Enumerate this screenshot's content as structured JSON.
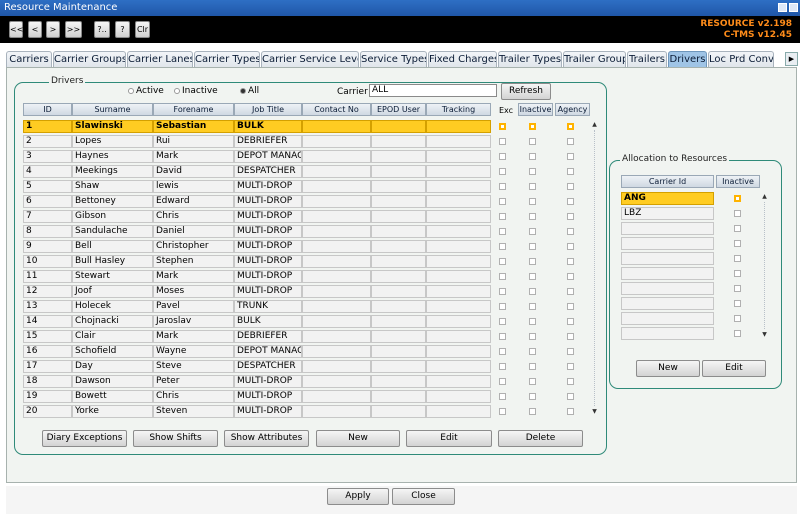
{
  "window": {
    "title": "Resource Maintenance"
  },
  "toolbar": {
    "buttons": [
      "<<",
      "<",
      ">",
      ">>",
      "?..",
      "?",
      "Clr"
    ],
    "version_resource": "RESOURCE v2.198",
    "version_ctms": "C-TMS v12.45"
  },
  "tabs": [
    "Carriers",
    "Carrier Groups",
    "Carrier Lanes",
    "Carrier Types",
    "Carrier Service Level",
    "Service Types",
    "Fixed Charges",
    "Trailer Types",
    "Trailer Group",
    "Trailers",
    "Drivers",
    "Loc Prd Conv"
  ],
  "tab_scroll_icon": "chevron-right-icon",
  "drivers": {
    "group_title": "Drivers",
    "filter": {
      "active_label": "Active",
      "inactive_label": "Inactive",
      "all_label": "All",
      "selected": "All"
    },
    "carrier_label": "Carrier",
    "carrier_value": "ALL",
    "refresh_label": "Refresh",
    "columns": [
      "ID",
      "Surname",
      "Forename",
      "Job Title",
      "Contact No",
      "EPOD User",
      "Tracking",
      "Exc",
      "Inactive",
      "Agency"
    ],
    "rows": [
      {
        "id": "1",
        "surname": "Slawinski",
        "forename": "Sebastian",
        "job": "BULK"
      },
      {
        "id": "2",
        "surname": "Lopes",
        "forename": "Rui",
        "job": "DEBRIEFER"
      },
      {
        "id": "3",
        "surname": "Haynes",
        "forename": "Mark",
        "job": "DEPOT MANAG"
      },
      {
        "id": "4",
        "surname": "Meekings",
        "forename": "David",
        "job": "DESPATCHER"
      },
      {
        "id": "5",
        "surname": "Shaw",
        "forename": "lewis",
        "job": "MULTI-DROP"
      },
      {
        "id": "6",
        "surname": "Bettoney",
        "forename": "Edward",
        "job": "MULTI-DROP"
      },
      {
        "id": "7",
        "surname": "Gibson",
        "forename": "Chris",
        "job": "MULTI-DROP"
      },
      {
        "id": "8",
        "surname": "Sandulache",
        "forename": "Daniel",
        "job": "MULTI-DROP"
      },
      {
        "id": "9",
        "surname": "Bell",
        "forename": "Christopher",
        "job": "MULTI-DROP"
      },
      {
        "id": "10",
        "surname": "Bull Hasley",
        "forename": "Stephen",
        "job": "MULTI-DROP"
      },
      {
        "id": "11",
        "surname": "Stewart",
        "forename": "Mark",
        "job": "MULTI-DROP"
      },
      {
        "id": "12",
        "surname": "Joof",
        "forename": "Moses",
        "job": "MULTI-DROP"
      },
      {
        "id": "13",
        "surname": "Holecek",
        "forename": "Pavel",
        "job": "TRUNK"
      },
      {
        "id": "14",
        "surname": "Chojnacki",
        "forename": "Jaroslav",
        "job": "BULK"
      },
      {
        "id": "15",
        "surname": "Clair",
        "forename": "Mark",
        "job": "DEBRIEFER"
      },
      {
        "id": "16",
        "surname": "Schofield",
        "forename": "Wayne",
        "job": "DEPOT MANAG"
      },
      {
        "id": "17",
        "surname": "Day",
        "forename": "Steve",
        "job": "DESPATCHER"
      },
      {
        "id": "18",
        "surname": "Dawson",
        "forename": "Peter",
        "job": "MULTI-DROP"
      },
      {
        "id": "19",
        "surname": "Bowett",
        "forename": "Chris",
        "job": "MULTI-DROP"
      },
      {
        "id": "20",
        "surname": "Yorke",
        "forename": "Steven",
        "job": "MULTI-DROP"
      }
    ],
    "buttons": [
      "Diary Exceptions",
      "Show Shifts",
      "Show Attributes",
      "New",
      "Edit",
      "Delete"
    ]
  },
  "allocation": {
    "group_title": "Allocation to Resources",
    "columns": [
      "Carrier Id",
      "Inactive"
    ],
    "rows": [
      "ANG",
      "LBZ",
      "",
      "",
      "",
      "",
      "",
      "",
      "",
      ""
    ],
    "buttons": [
      "New",
      "Edit"
    ]
  },
  "footer": {
    "apply_label": "Apply",
    "close_label": "Close"
  },
  "colors": {
    "highlight": "#ffcc22",
    "active_tab": "#9fc4e6",
    "version_text": "#ff8c1a",
    "group_border": "#2f8a79"
  }
}
